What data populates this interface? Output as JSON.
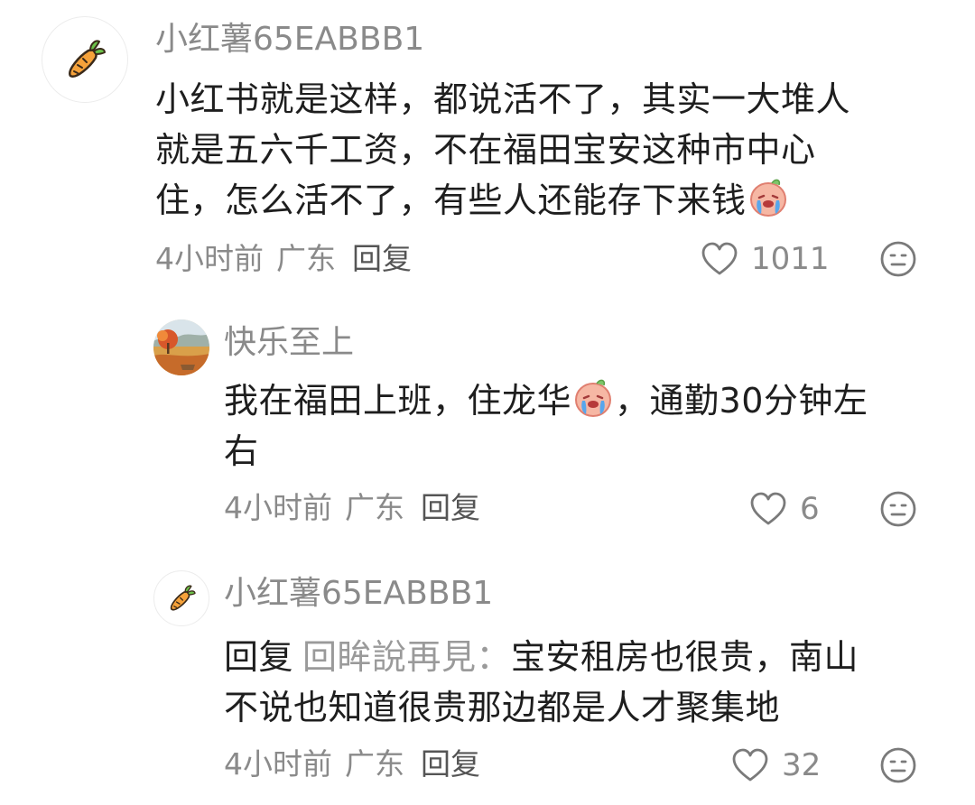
{
  "comments": [
    {
      "username": "小红薯65EABBB1",
      "lines": [
        "小红书就是这样，都说活不了，其实一大堆人",
        "就是五六千工资，不在福田宝安这种市中心",
        "住，怎么活不了，有些人还能存下来钱"
      ],
      "time": "4小时前",
      "location": "广东",
      "reply_label": "回复",
      "likes": "1011",
      "avatar_icon": "carrot-icon",
      "trailing_emoji": "crying-face-emoji"
    },
    {
      "username": "快乐至上",
      "line1_a": "我在福田上班，住龙华",
      "line1_b": "，通勤30分钟左",
      "line2": "右",
      "time": "4小时前",
      "location": "广东",
      "reply_label": "回复",
      "likes": "6",
      "avatar_icon": "autumn-landscape-avatar",
      "inline_emoji": "crying-face-emoji"
    },
    {
      "username": "小红薯65EABBB1",
      "reply_prefix": "回复",
      "reply_target": "回眸說再見：",
      "line1_rest": "宝安租房也很贵，南山",
      "line2": "不说也知道很贵那边都是人才聚集地",
      "time": "4小时前",
      "location": "广东",
      "reply_label": "回复",
      "likes": "32",
      "avatar_icon": "carrot-icon"
    }
  ],
  "colors": {
    "muted_text": "#8a8a8a",
    "body_text": "#1e1e1e",
    "icon_stroke": "#7a7a7a"
  }
}
